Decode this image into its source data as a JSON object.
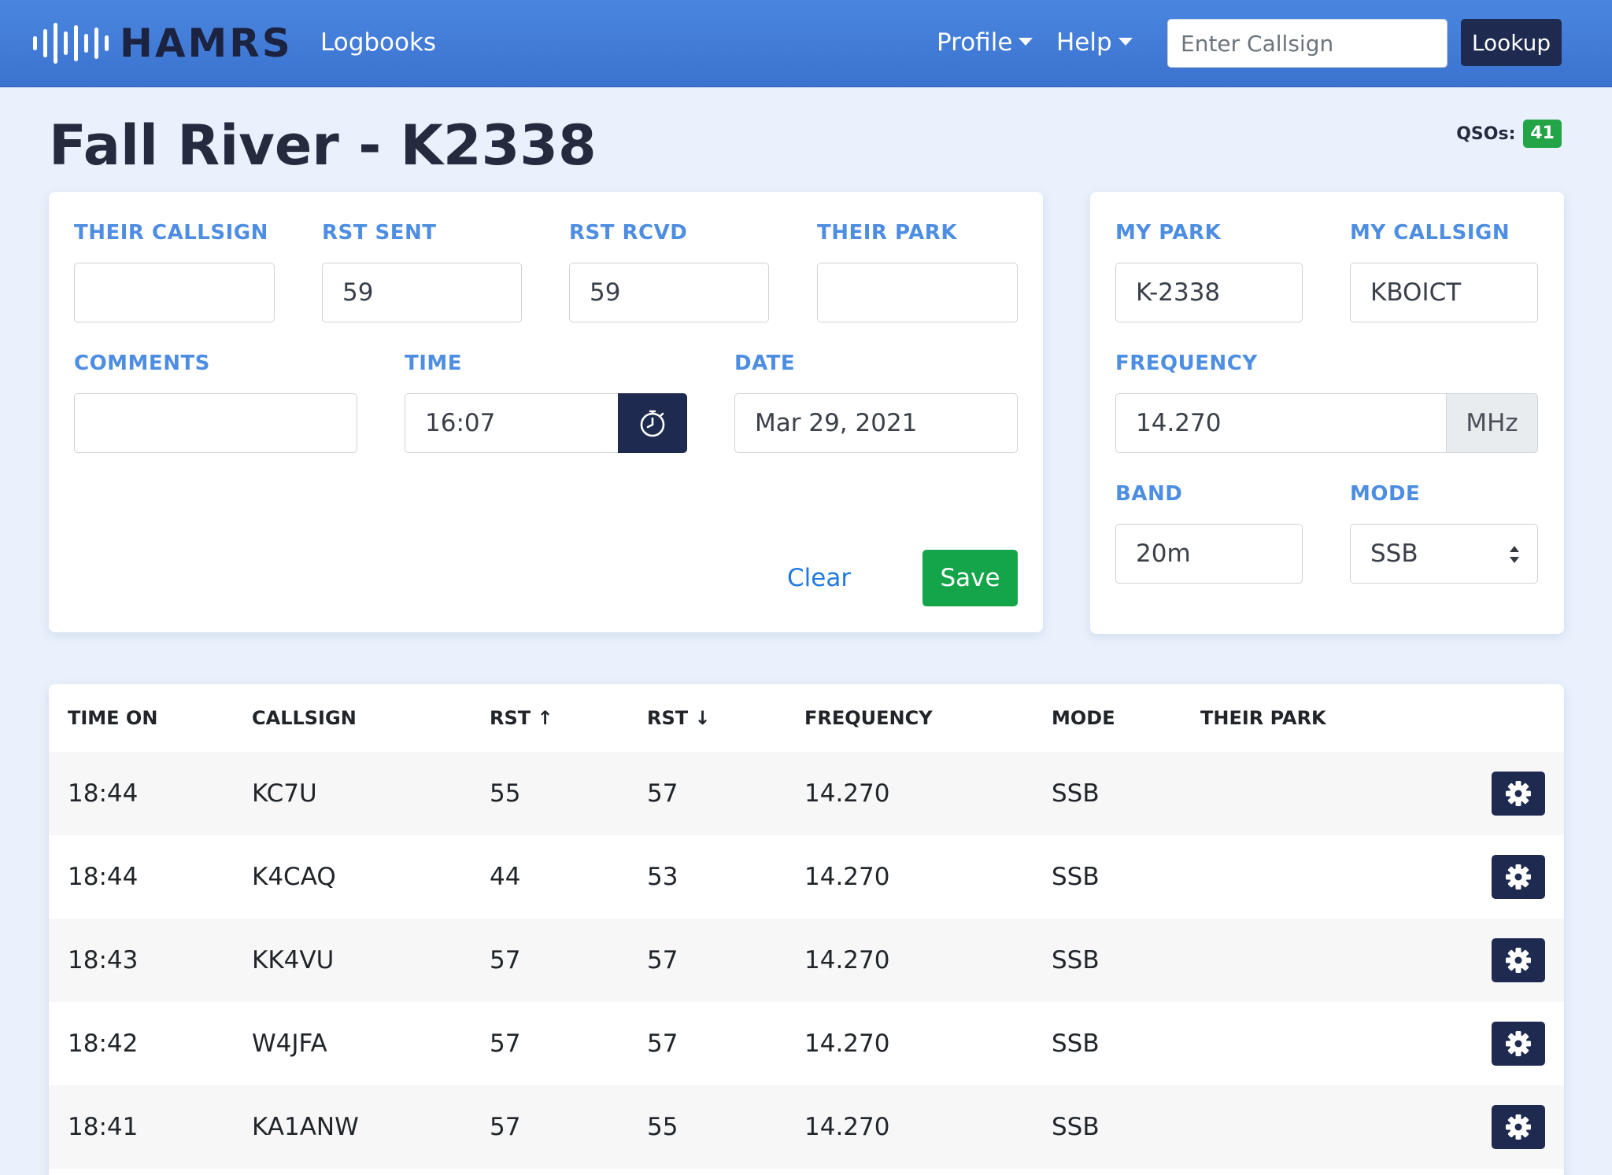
{
  "nav": {
    "brand": "HAMRS",
    "logbooks": "Logbooks",
    "profile": "Profile",
    "help": "Help",
    "search_placeholder": "Enter Callsign",
    "lookup": "Lookup"
  },
  "page": {
    "title": "Fall River - K2338",
    "qso_label": "QSOs:",
    "qso_count": "41"
  },
  "entry": {
    "their_callsign_label": "THEIR CALLSIGN",
    "their_callsign_value": "",
    "rst_sent_label": "RST SENT",
    "rst_sent_value": "59",
    "rst_rcvd_label": "RST RCVD",
    "rst_rcvd_value": "59",
    "their_park_label": "THEIR PARK",
    "their_park_value": "",
    "comments_label": "COMMENTS",
    "comments_value": "",
    "time_label": "TIME",
    "time_value": "16:07",
    "date_label": "DATE",
    "date_value": "Mar 29, 2021",
    "clear": "Clear",
    "save": "Save"
  },
  "station": {
    "my_park_label": "MY PARK",
    "my_park_value": "K-2338",
    "my_callsign_label": "MY CALLSIGN",
    "my_callsign_value": "KBOICT",
    "frequency_label": "FREQUENCY",
    "frequency_value": "14.270",
    "frequency_unit": "MHz",
    "band_label": "BAND",
    "band_value": "20m",
    "mode_label": "MODE",
    "mode_value": "SSB"
  },
  "table": {
    "headers": {
      "time_on": "TIME ON",
      "callsign": "CALLSIGN",
      "rst_sent": "RST ↑",
      "rst_rcvd": "RST ↓",
      "frequency": "FREQUENCY",
      "mode": "MODE",
      "their_park": "THEIR PARK"
    },
    "rows": [
      {
        "time": "18:44",
        "callsign": "KC7U",
        "rst_sent": "55",
        "rst_rcvd": "57",
        "frequency": "14.270",
        "mode": "SSB",
        "park": ""
      },
      {
        "time": "18:44",
        "callsign": "K4CAQ",
        "rst_sent": "44",
        "rst_rcvd": "53",
        "frequency": "14.270",
        "mode": "SSB",
        "park": ""
      },
      {
        "time": "18:43",
        "callsign": "KK4VU",
        "rst_sent": "57",
        "rst_rcvd": "57",
        "frequency": "14.270",
        "mode": "SSB",
        "park": ""
      },
      {
        "time": "18:42",
        "callsign": "W4JFA",
        "rst_sent": "57",
        "rst_rcvd": "57",
        "frequency": "14.270",
        "mode": "SSB",
        "park": ""
      },
      {
        "time": "18:41",
        "callsign": "KA1ANW",
        "rst_sent": "57",
        "rst_rcvd": "55",
        "frequency": "14.270",
        "mode": "SSB",
        "park": ""
      }
    ]
  },
  "icons": {
    "timer": "stopwatch-icon",
    "row_action": "gear-icon",
    "logo": "sound-wave-icon",
    "select": "select-arrows-icon"
  },
  "colors": {
    "navbar": "#3f7ad8",
    "dark_button": "#1e2a4f",
    "label_blue": "#4d8de2",
    "save_green": "#14a54a",
    "badge_green": "#22a447",
    "page_bg": "#eaf1fc"
  }
}
